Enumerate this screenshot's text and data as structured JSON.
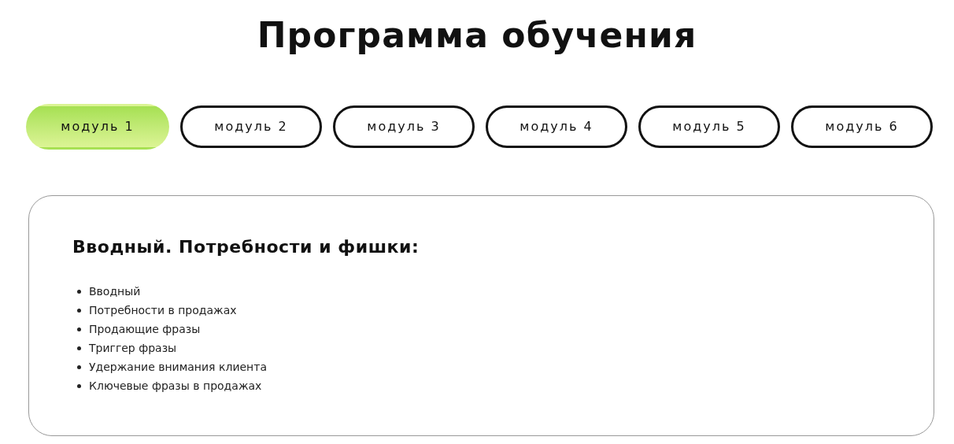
{
  "title": "Программа обучения",
  "tabs": [
    {
      "label": "модуль 1",
      "selected": true
    },
    {
      "label": "модуль 2",
      "selected": false
    },
    {
      "label": "модуль 3",
      "selected": false
    },
    {
      "label": "модуль 4",
      "selected": false
    },
    {
      "label": "модуль 5",
      "selected": false
    },
    {
      "label": "модуль 6",
      "selected": false
    }
  ],
  "module": {
    "heading": "Вводный. Потребности и фишки:",
    "items": [
      "Вводный",
      "Потребности в продажах",
      "Продающие фразы",
      "Триггер фразы",
      "Удержание внимания клиента",
      "Ключевые фразы в продажах"
    ]
  }
}
